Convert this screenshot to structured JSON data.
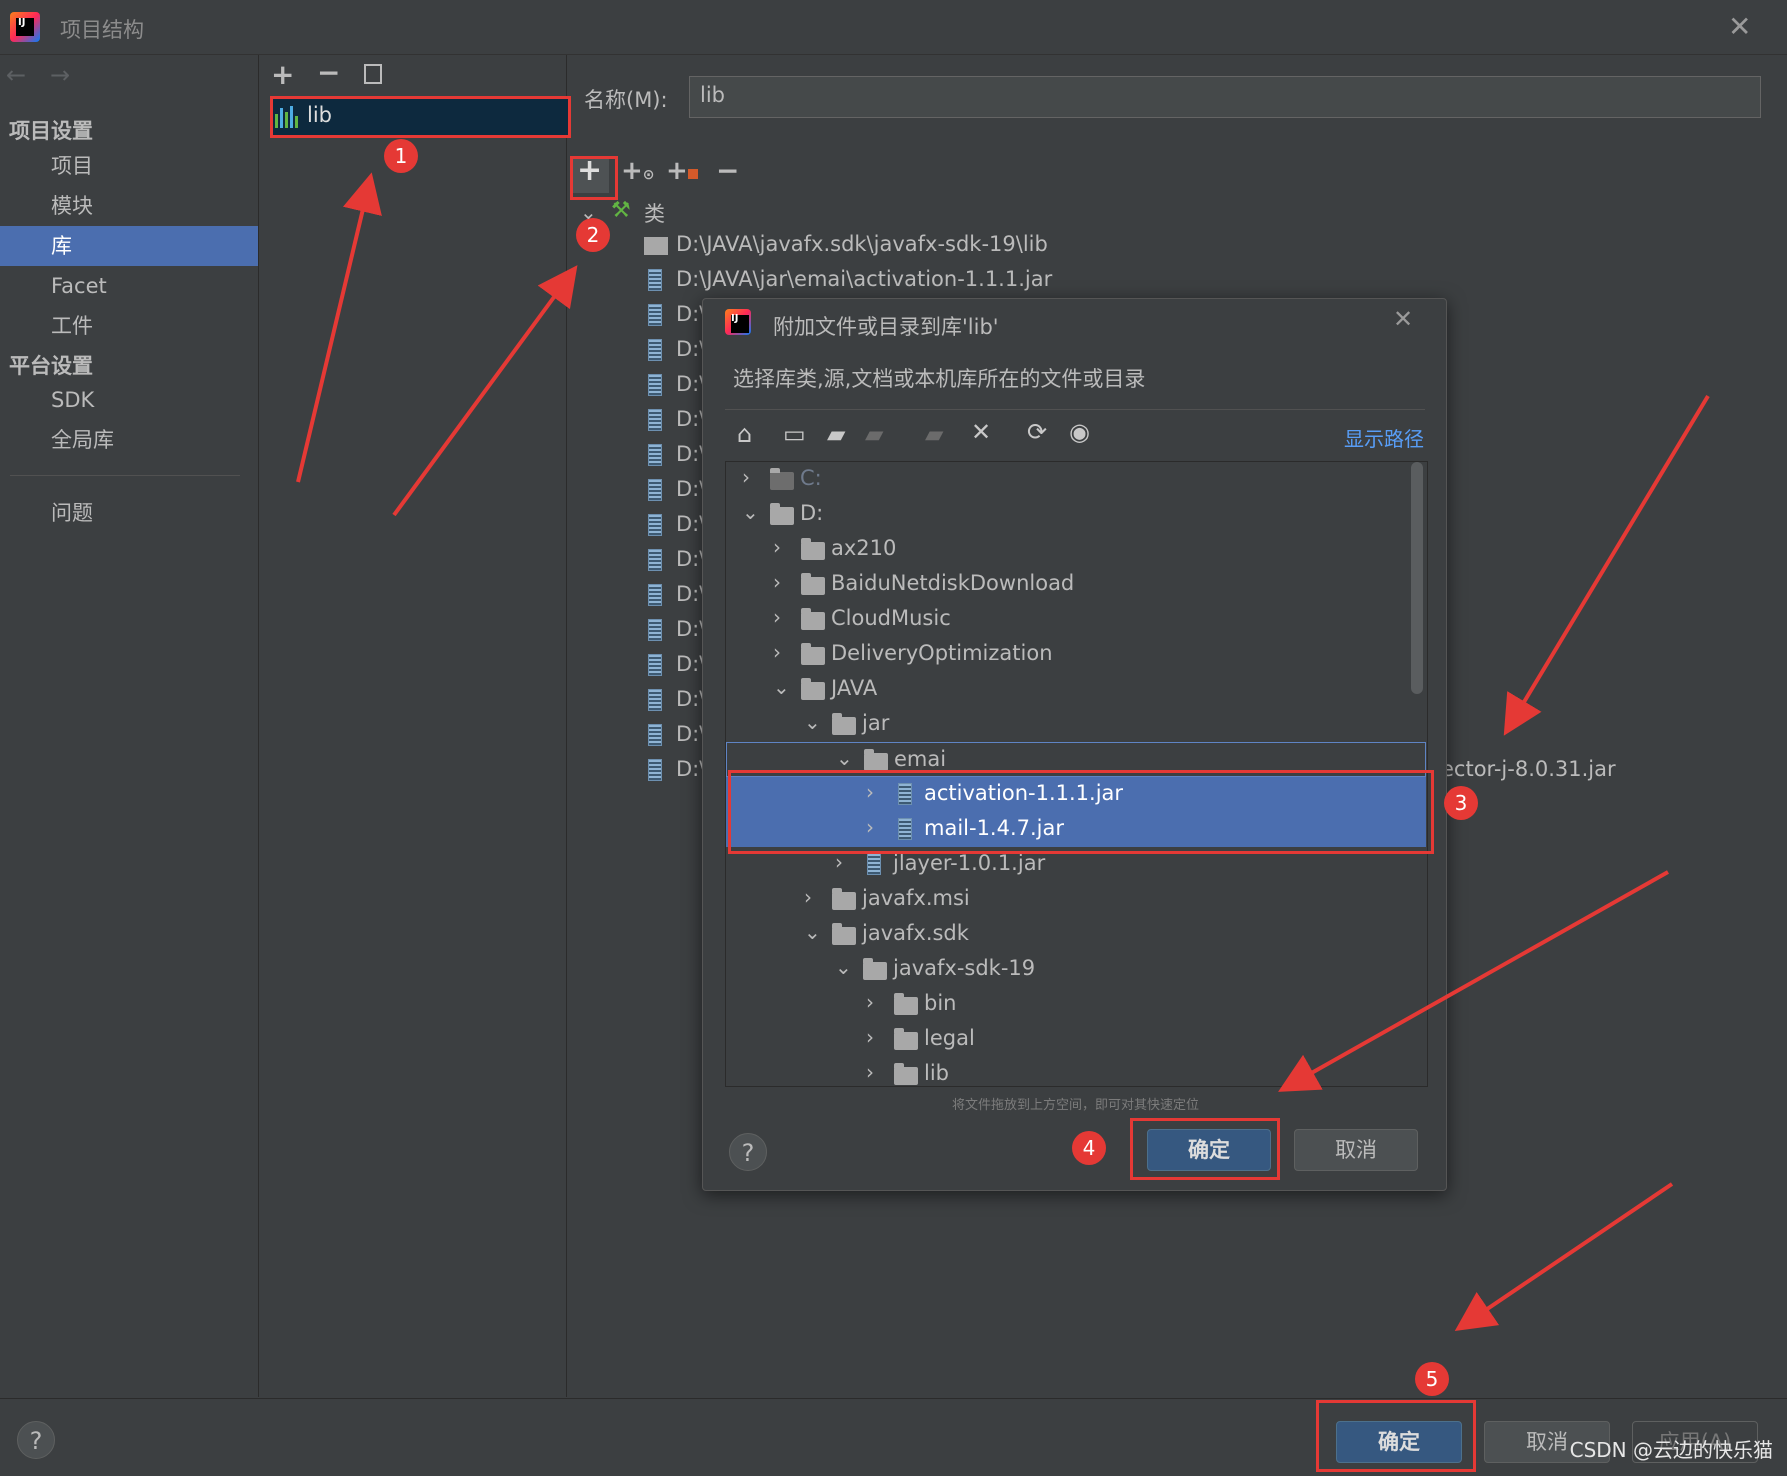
{
  "window": {
    "title": "项目结构",
    "watermark": "CSDN @云边的快乐猫"
  },
  "sidebar": {
    "project_settings_header": "项目设置",
    "project_items": [
      {
        "label": "项目"
      },
      {
        "label": "模块"
      },
      {
        "label": "库"
      },
      {
        "label": "Facet"
      },
      {
        "label": "工件"
      }
    ],
    "platform_settings_header": "平台设置",
    "platform_items": [
      {
        "label": "SDK"
      },
      {
        "label": "全局库"
      }
    ],
    "problems_label": "问题",
    "selected": "库"
  },
  "library_list": {
    "items": [
      {
        "name": "lib"
      }
    ]
  },
  "detail": {
    "name_label": "名称(M):",
    "name_value": "lib",
    "classes_node": "类",
    "paths": [
      "D:\\JAVA\\javafx.sdk\\javafx-sdk-19\\lib",
      "D:\\JAVA\\jar\\emai\\activation-1.1.1.jar",
      "D:\\",
      "D:\\",
      "D:\\",
      "D:\\",
      "D:\\",
      "D:\\",
      "D:\\",
      "D:\\",
      "D:\\",
      "D:\\",
      "D:\\",
      "D:\\",
      "D:\\",
      "D:\\"
    ],
    "partial_path_suffix": "ector-j-8.0.31.jar"
  },
  "dialog": {
    "title": "附加文件或目录到库'lib'",
    "description": "选择库类,源,文档或本机库所在的文件或目录",
    "show_path_link": "显示路径",
    "tree": [
      {
        "label": "C:",
        "type": "drive",
        "depth": 0,
        "expanded": false,
        "dim": true
      },
      {
        "label": "D:",
        "type": "drive",
        "depth": 0,
        "expanded": true
      },
      {
        "label": "ax210",
        "type": "folder",
        "depth": 1,
        "expanded": false
      },
      {
        "label": "BaiduNetdiskDownload",
        "type": "folder",
        "depth": 1,
        "expanded": false
      },
      {
        "label": "CloudMusic",
        "type": "folder",
        "depth": 1,
        "expanded": false
      },
      {
        "label": "DeliveryOptimization",
        "type": "folder",
        "depth": 1,
        "expanded": false
      },
      {
        "label": "JAVA",
        "type": "folder",
        "depth": 1,
        "expanded": true
      },
      {
        "label": "jar",
        "type": "folder",
        "depth": 2,
        "expanded": true
      },
      {
        "label": "emai",
        "type": "folder",
        "depth": 3,
        "expanded": true,
        "focus": true
      },
      {
        "label": "activation-1.1.1.jar",
        "type": "jar",
        "depth": 4,
        "expanded": false,
        "selected": true
      },
      {
        "label": "mail-1.4.7.jar",
        "type": "jar",
        "depth": 4,
        "expanded": false,
        "selected": true
      },
      {
        "label": "jlayer-1.0.1.jar",
        "type": "jar",
        "depth": 3,
        "expanded": false
      },
      {
        "label": "javafx.msi",
        "type": "folder",
        "depth": 2,
        "expanded": false
      },
      {
        "label": "javafx.sdk",
        "type": "folder",
        "depth": 2,
        "expanded": true
      },
      {
        "label": "javafx-sdk-19",
        "type": "folder",
        "depth": 3,
        "expanded": true
      },
      {
        "label": "bin",
        "type": "folder",
        "depth": 4,
        "expanded": false
      },
      {
        "label": "legal",
        "type": "folder",
        "depth": 4,
        "expanded": false
      },
      {
        "label": "lib",
        "type": "folder",
        "depth": 4,
        "expanded": false
      }
    ],
    "drag_hint": "将文件拖放到上方空间，即可对其快速定位",
    "ok_label": "确定",
    "cancel_label": "取消"
  },
  "bottom": {
    "ok_label": "确定",
    "cancel_label": "取消",
    "apply_label": "应用(A)"
  },
  "annotations": [
    "1",
    "2",
    "3",
    "4",
    "5"
  ],
  "colors": {
    "background": "#3c3f41",
    "selection": "#4b6eaf",
    "primary_button": "#365880",
    "annotation_red": "#e53935",
    "link": "#589df6"
  }
}
